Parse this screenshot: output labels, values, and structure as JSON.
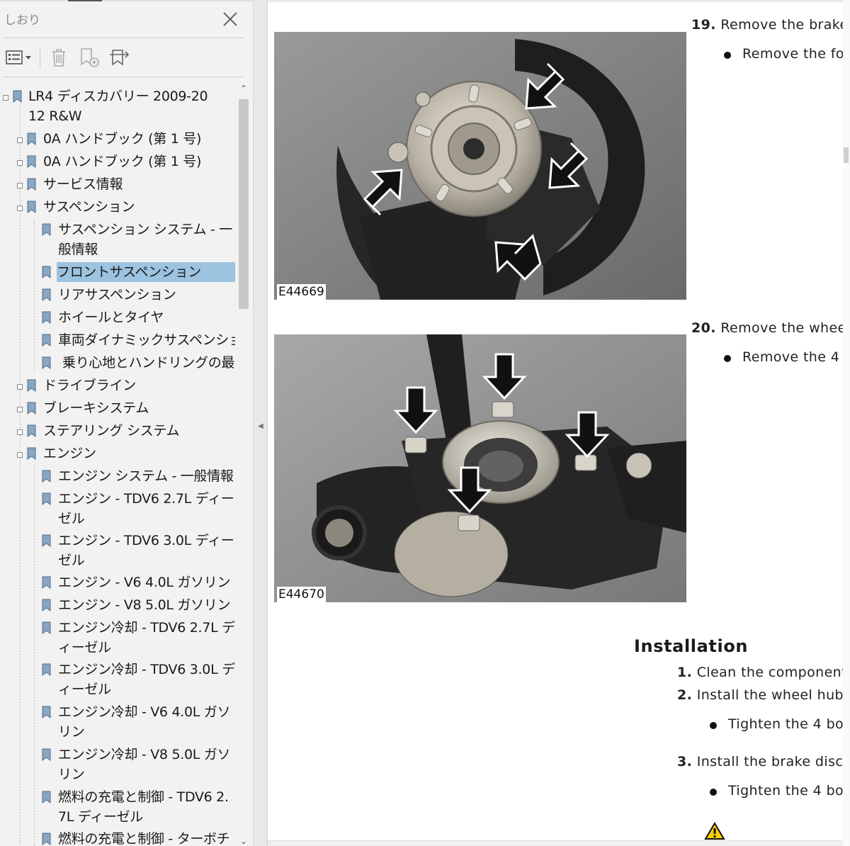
{
  "bookmarks_pane": {
    "title": "しおり",
    "toolbar": {
      "options_icon": "options-menu-icon",
      "delete_icon": "trash-icon",
      "new_bookmark_icon": "add-bookmark-icon",
      "expand_icon": "find-current-bookmark-icon"
    },
    "tree": [
      {
        "label": "LR4 ディスカバリー 2009-2012 R&W",
        "level": 0,
        "expandable": true
      },
      {
        "label": "0A ハンドブック (第 1 号)",
        "level": 1,
        "expandable": true
      },
      {
        "label": "0A ハンドブック (第 1 号)",
        "level": 1,
        "expandable": true
      },
      {
        "label": "サービス情報",
        "level": 1,
        "expandable": true
      },
      {
        "label": "サスペンション",
        "level": 1,
        "expandable": true
      },
      {
        "label": "サスペンション システム - 一般情報",
        "level": 2,
        "expandable": false
      },
      {
        "label": "フロントサスペンション",
        "level": 2,
        "expandable": false,
        "selected": true
      },
      {
        "label": "リアサスペンション",
        "level": 2,
        "expandable": false
      },
      {
        "label": "ホイールとタイヤ",
        "level": 2,
        "expandable": false
      },
      {
        "label": "車両ダイナミックサスペンション",
        "level": 2,
        "expandable": false
      },
      {
        "label": "乗り心地とハンドリングの最適化",
        "level": 2,
        "expandable": false
      },
      {
        "label": "ドライブライン",
        "level": 1,
        "expandable": true
      },
      {
        "label": "ブレーキシステム",
        "level": 1,
        "expandable": true
      },
      {
        "label": "ステアリング システム",
        "level": 1,
        "expandable": true
      },
      {
        "label": "エンジン",
        "level": 1,
        "expandable": true
      },
      {
        "label": "エンジン システム - 一般情報",
        "level": 2,
        "expandable": false
      },
      {
        "label": "エンジン - TDV6 2.7L ディーゼル",
        "level": 2,
        "expandable": false
      },
      {
        "label": "エンジン - TDV6 3.0L ディーゼル",
        "level": 2,
        "expandable": false
      },
      {
        "label": "エンジン - V6 4.0L ガソリン",
        "level": 2,
        "expandable": false
      },
      {
        "label": "エンジン - V8 5.0L ガソリン",
        "level": 2,
        "expandable": false
      },
      {
        "label": "エンジン冷却 - TDV6 2.7L ディーゼル",
        "level": 2,
        "expandable": false
      },
      {
        "label": "エンジン冷却 - TDV6 3.0L ディーゼル",
        "level": 2,
        "expandable": false
      },
      {
        "label": "エンジン冷却 - V6 4.0L ガソリン",
        "level": 2,
        "expandable": false
      },
      {
        "label": "エンジン冷却 - V8 5.0L ガソリン",
        "level": 2,
        "expandable": false
      },
      {
        "label": "燃料の充電と制御 - TDV6 2.7L ディーゼル",
        "level": 2,
        "expandable": false
      },
      {
        "label": "燃料の充電と制御 - ターボチ",
        "level": 2,
        "expandable": false
      }
    ]
  },
  "document": {
    "figure1_caption": "E44669",
    "figure2_caption": "E44670",
    "step19": {
      "num": "19.",
      "text": "Remove the brake"
    },
    "step19_bullet": "Remove the fo",
    "step20": {
      "num": "20.",
      "text": "Remove the whee"
    },
    "step20_bullet": "Remove the 4",
    "installation_heading": "Installation",
    "install_steps": [
      {
        "num": "1.",
        "text": "Clean the component"
      },
      {
        "num": "2.",
        "text": "Install the wheel hub"
      },
      {
        "num": "3.",
        "text": "Install the brake disc"
      }
    ],
    "install_bullets": [
      "Tighten the 4 bo",
      "Tighten the 4 bo"
    ],
    "warning_icon": "warning-triangle-icon"
  },
  "colors": {
    "selection": "#9cc3e0",
    "pane_bg": "#f2f2f2",
    "warning": "#f5d000"
  }
}
